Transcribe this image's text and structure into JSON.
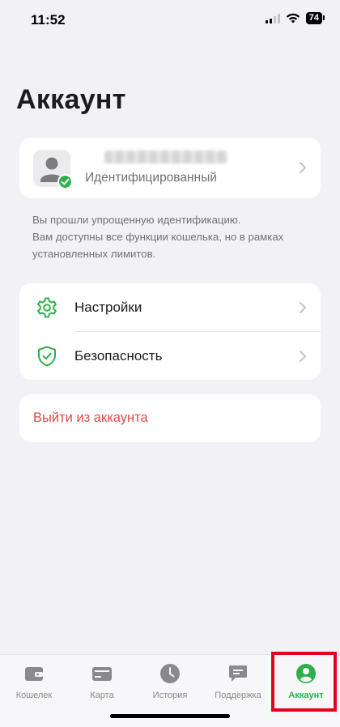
{
  "status_bar": {
    "time": "11:52",
    "battery": "74",
    "icons": [
      "signal-icon",
      "wifi-icon",
      "battery-icon"
    ]
  },
  "page": {
    "title": "Аккаунт"
  },
  "profile": {
    "status": "Идентифицированный",
    "verified": true
  },
  "info": {
    "line1": "Вы прошли упрощенную идентификацию.",
    "line2": "Вам доступны все функции кошелька, но в рамках установленных лимитов."
  },
  "menu": {
    "items": [
      {
        "label": "Настройки",
        "icon": "gear-icon"
      },
      {
        "label": "Безопасность",
        "icon": "shield-icon"
      }
    ]
  },
  "logout": {
    "label": "Выйти из аккаунта"
  },
  "tab_bar": {
    "tabs": [
      {
        "label": "Кошелек",
        "icon": "wallet-icon"
      },
      {
        "label": "Карта",
        "icon": "card-icon"
      },
      {
        "label": "История",
        "icon": "clock-icon"
      },
      {
        "label": "Поддержка",
        "icon": "chat-icon"
      },
      {
        "label": "Аккаунт",
        "icon": "user-icon"
      }
    ],
    "active_index": 4
  },
  "colors": {
    "accent": "#30b04a",
    "danger": "#e14a45",
    "background": "#f2f2f6",
    "highlight": "#e3001b"
  }
}
